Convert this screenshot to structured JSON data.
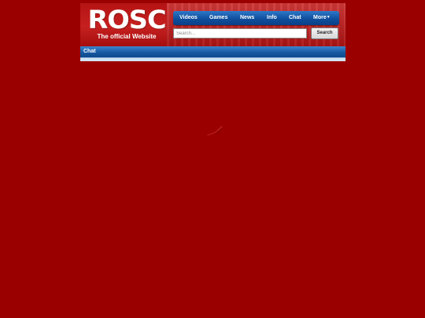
{
  "header": {
    "logo_text": "ROSC",
    "logo_subtitle": "The official Website"
  },
  "nav": {
    "items": [
      {
        "label": "Videos"
      },
      {
        "label": "Games"
      },
      {
        "label": "News"
      },
      {
        "label": "Info"
      },
      {
        "label": "Chat"
      },
      {
        "label": "More"
      }
    ]
  },
  "search": {
    "placeholder": "Search...",
    "value": "",
    "button_label": "Search"
  },
  "section": {
    "title": "Chat"
  },
  "colors": {
    "page_background": "#9b0000",
    "header_red": "#c62020",
    "nav_blue": "#0f4f9e",
    "content_light_blue": "#cfe3f3"
  },
  "icons": {
    "more_dropdown": "chevron-down-icon",
    "loading": "loading-spinner-icon"
  }
}
